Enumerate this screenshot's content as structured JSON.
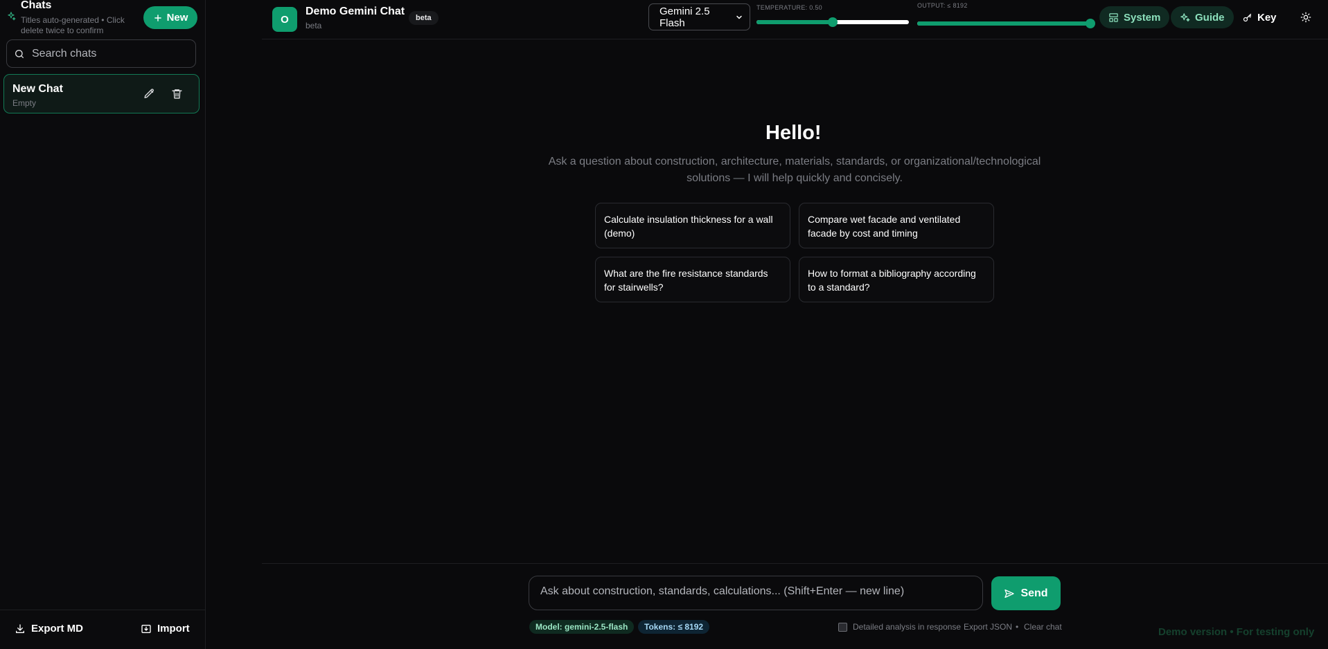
{
  "sidebar": {
    "title": "Chats",
    "subtitle": "Titles auto-generated • Click delete twice to confirm",
    "new_label": "New",
    "search_placeholder": "Search chats",
    "chats": [
      {
        "title": "New Chat",
        "subtitle": "Empty"
      }
    ],
    "export_label": "Export MD",
    "import_label": "Import"
  },
  "header": {
    "logo_letter": "O",
    "app_title": "Demo Gemini Chat",
    "app_subtitle": "beta",
    "badge": "beta",
    "model_selected": "Gemini 2.5 Flash",
    "temperature_label": "TEMPERATURE: 0.50",
    "temperature_value": 0.5,
    "temperature_fraction": 0.5,
    "output_label": "OUTPUT: ≤ 8192",
    "output_fraction": 1.0,
    "system_label": "System",
    "guide_label": "Guide",
    "key_label": "Key"
  },
  "main": {
    "greeting": "Hello!",
    "intro": "Ask a question about construction, architecture, materials, standards, or organizational/technological solutions — I will help quickly and concisely.",
    "suggestions": [
      "Calculate insulation thickness for a wall (demo)",
      "Compare wet facade and ventilated facade by cost and timing",
      "What are the fire resistance standards for stairwells?",
      "How to format a bibliography according to a standard?"
    ]
  },
  "composer": {
    "placeholder": "Ask about construction, standards, calculations... (Shift+Enter — new line)",
    "send_label": "Send",
    "model_chip": "Model: gemini-2.5-flash",
    "tokens_chip": "Tokens: ≤ 8192",
    "detailed_label": "Detailed analysis in response",
    "detailed_checked": false,
    "export_json_label": "Export JSON",
    "separator": "•",
    "clear_label": "Clear chat"
  },
  "footer": {
    "watermark": "Demo version • For testing only"
  },
  "colors": {
    "background": "#0a0a0c",
    "accent": "#0f9d6e",
    "muted_text": "#7b7d84",
    "border": "#1e1f22"
  },
  "icons": [
    "sparkle-icon",
    "plus-icon",
    "search-icon",
    "edit-icon",
    "trash-icon",
    "download-icon",
    "import-icon",
    "chevron-down-icon",
    "layout-icon",
    "key-icon",
    "sun-icon",
    "send-icon"
  ]
}
